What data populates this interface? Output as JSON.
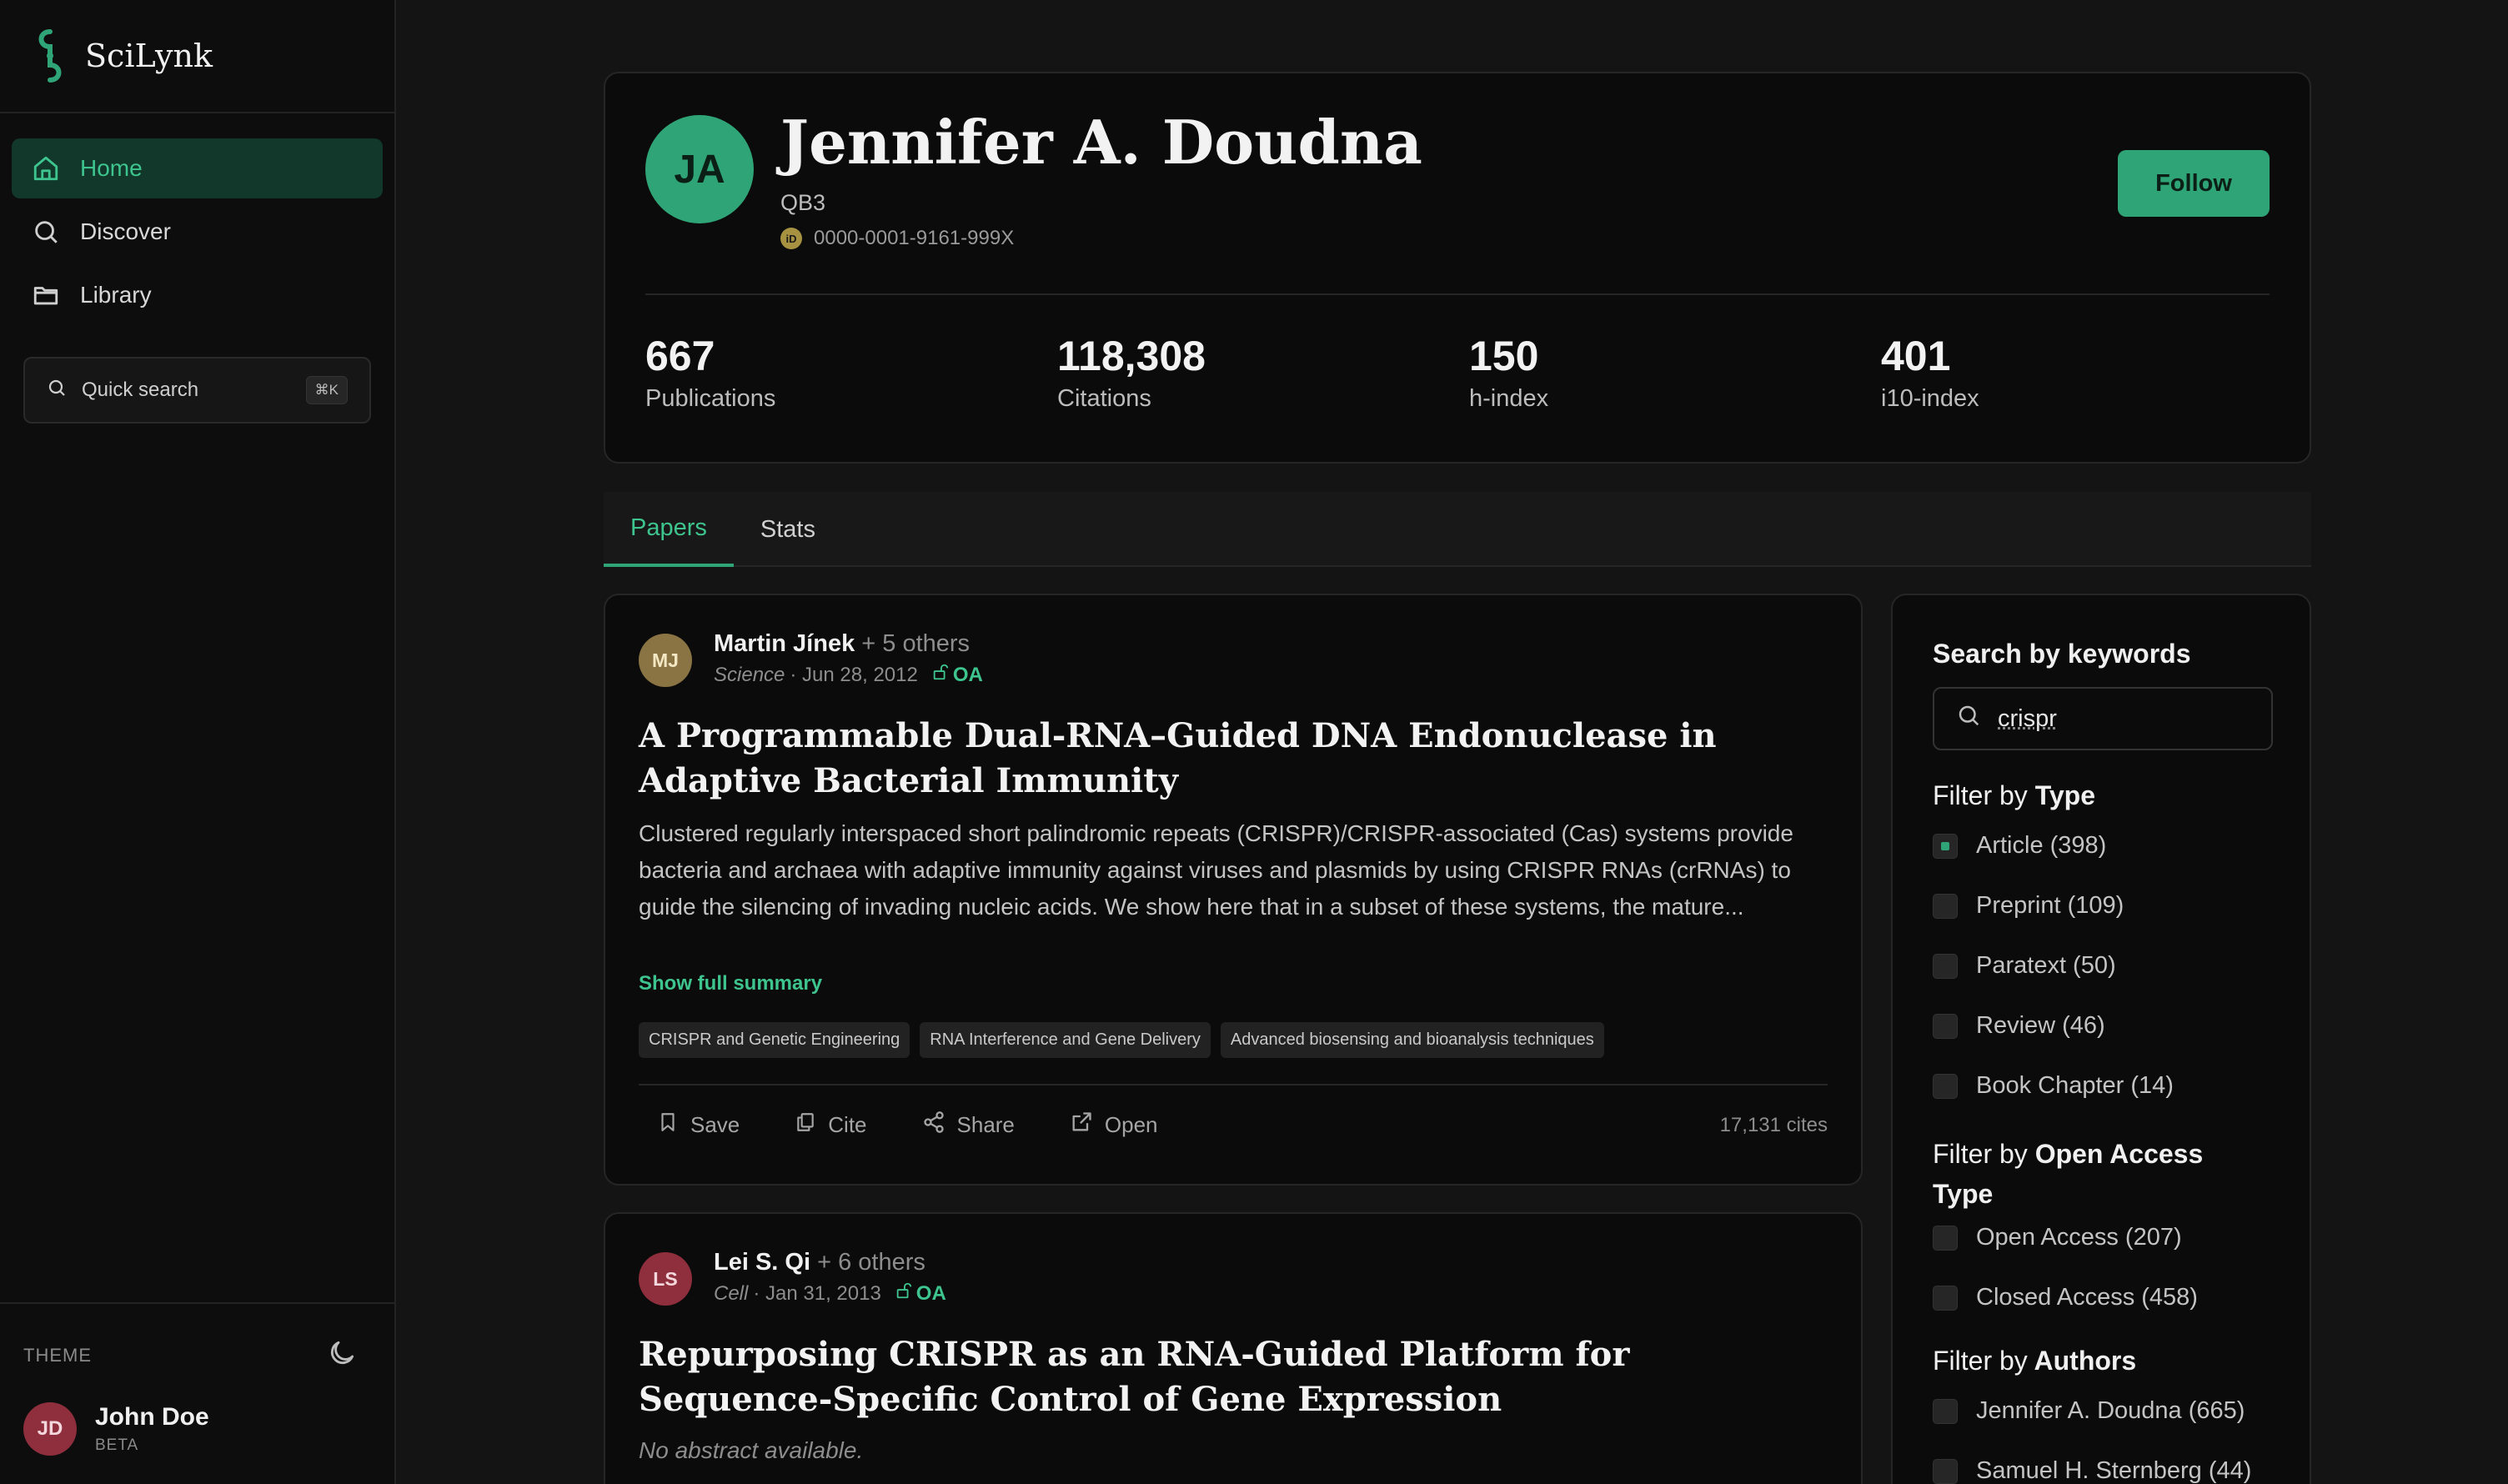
{
  "app": {
    "name": "SciLynk"
  },
  "nav": [
    {
      "label": "Home",
      "icon": "home-icon",
      "active": true
    },
    {
      "label": "Discover",
      "icon": "search-icon",
      "active": false
    },
    {
      "label": "Library",
      "icon": "folder-icon",
      "active": false
    }
  ],
  "quick_search": {
    "label": "Quick search",
    "shortcut": "⌘K"
  },
  "sidebar_bottom": {
    "theme_label": "THEME",
    "user": {
      "initials": "JD",
      "name": "John Doe",
      "badge": "BETA"
    }
  },
  "profile": {
    "initials": "JA",
    "name": "Jennifer A. Doudna",
    "affiliation": "QB3",
    "orcid_icon": "iD",
    "orcid": "0000-0001-9161-999X",
    "follow_label": "Follow",
    "stats": [
      {
        "value": "667",
        "label": "Publications"
      },
      {
        "value": "118,308",
        "label": "Citations"
      },
      {
        "value": "150",
        "label": "h-index"
      },
      {
        "value": "401",
        "label": "i10-index"
      }
    ]
  },
  "tabs": [
    {
      "label": "Papers",
      "active": true
    },
    {
      "label": "Stats",
      "active": false
    }
  ],
  "papers": [
    {
      "initials": "MJ",
      "avatar_color": "#8a7443",
      "author": "Martin Jínek",
      "others": "+ 5 others",
      "journal": "Science",
      "date": "· Jun 28, 2012",
      "oa": "OA",
      "title": "A Programmable Dual-RNA–Guided DNA Endonuclease in Adaptive Bacterial Immunity",
      "abstract": "Clustered regularly interspaced short palindromic repeats (CRISPR)/CRISPR-associated (Cas) systems provide bacteria and archaea with adaptive immunity against viruses and plasmids by using CRISPR RNAs (crRNAs) to guide the silencing of invading nucleic acids. We show here that in a subset of these systems, the mature...",
      "show_more": "Show full summary",
      "tags": [
        "CRISPR and Genetic Engineering",
        "RNA Interference and Gene Delivery",
        "Advanced biosensing and bioanalysis techniques"
      ],
      "actions": {
        "save": "Save",
        "cite": "Cite",
        "share": "Share",
        "open": "Open"
      },
      "cites": "17,131 cites"
    },
    {
      "initials": "LS",
      "avatar_color": "#8f2e3c",
      "author": "Lei S. Qi",
      "others": "+ 6 others",
      "journal": "Cell",
      "date": "· Jan 31, 2013",
      "oa": "OA",
      "title": "Repurposing CRISPR as an RNA-Guided Platform for Sequence-Specific Control of Gene Expression",
      "abstract": "No abstract available."
    }
  ],
  "filters": {
    "search_heading": "Search by keywords",
    "search_value": "crispr",
    "filter_word": "Filter by",
    "type_heading": "Type",
    "types": [
      {
        "label": "Article (398)",
        "checked": true
      },
      {
        "label": "Preprint (109)",
        "checked": false
      },
      {
        "label": "Paratext (50)",
        "checked": false
      },
      {
        "label": "Review (46)",
        "checked": false
      },
      {
        "label": "Book Chapter (14)",
        "checked": false
      }
    ],
    "oa_heading_line1": "Open Access",
    "oa_heading_line2": "Type",
    "oa_types": [
      {
        "label": "Open Access (207)",
        "checked": false
      },
      {
        "label": "Closed Access (458)",
        "checked": false
      }
    ],
    "authors_heading": "Authors",
    "authors": [
      {
        "label": "Jennifer A. Doudna (665)",
        "checked": false
      },
      {
        "label": "Samuel H. Sternberg (44)",
        "checked": false
      }
    ]
  },
  "colors": {
    "accent": "#2fa577",
    "accent_text": "#3ec48e",
    "background": "#141414",
    "card": "#0b0b0b"
  }
}
